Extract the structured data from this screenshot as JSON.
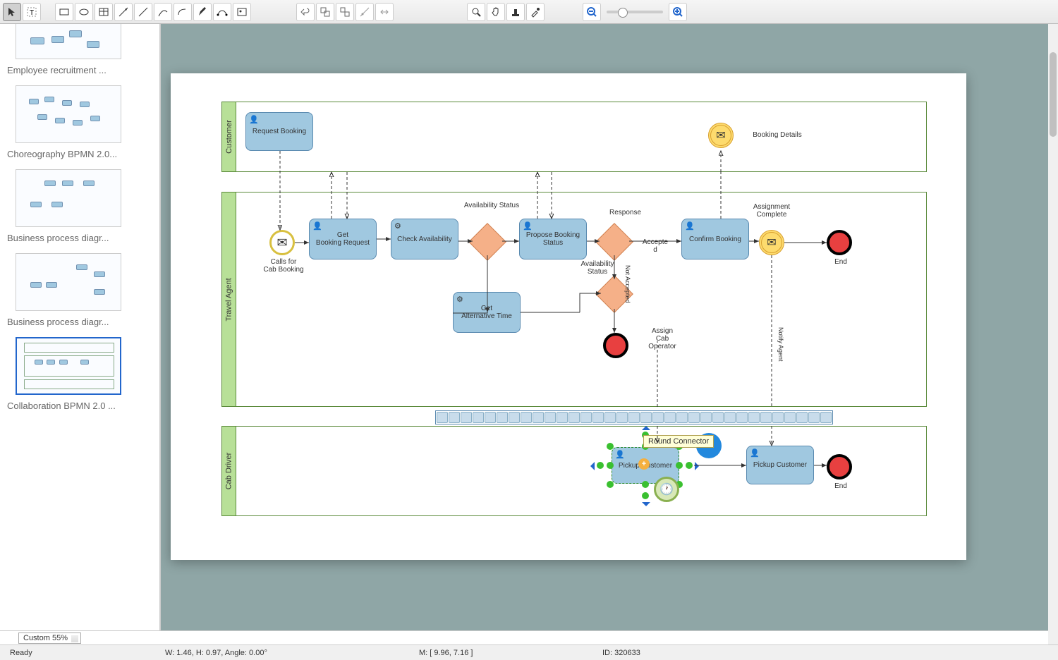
{
  "toolbar": {
    "tools": [
      "select",
      "text",
      "rect",
      "ellipse",
      "table",
      "connector",
      "line",
      "curve",
      "freehand",
      "pen",
      "dimension",
      "insert"
    ]
  },
  "sidebar": {
    "items": [
      {
        "label": "Employee recruitment ..."
      },
      {
        "label": "Choreography BPMN 2.0..."
      },
      {
        "label": "Business process diagr..."
      },
      {
        "label": "Business process diagr..."
      },
      {
        "label": "Collaboration BPMN 2.0 ..."
      }
    ]
  },
  "diagram": {
    "pools": [
      {
        "name": "Customer"
      },
      {
        "name": "Travel Agent"
      },
      {
        "name": "Cab Driver"
      }
    ],
    "tasks": {
      "request_booking": "Request Booking",
      "get_booking_request": "Get\nBooking Request",
      "check_availability": "Check Availability",
      "propose_booking_status": "Propose Booking Status",
      "get_alternative_time": "Get\nAlternative Time",
      "confirm_booking": "Confirm Booking",
      "pickup_customer_1": "Pickup Customer",
      "pickup_customer_2": "Pickup Customer"
    },
    "events": {
      "booking_details": "Booking Details",
      "calls_for_cab": "Calls for\nCab Booking",
      "assignment_complete": "Assignment\nComplete",
      "end1": "End",
      "end2": "End"
    },
    "labels": {
      "availability_status": "Availability Status",
      "availability_status_2": "Availability\nStatus",
      "response": "Response",
      "accepted": "Accepte\nd",
      "not_accepted": "Not Accepted",
      "assign_cab_operator": "Assign\nCab\nOperator",
      "notify_agent": "Notify Agent"
    }
  },
  "tooltip": "Round Connector",
  "statusbar": {
    "ready": "Ready",
    "zoom": "Custom 55%",
    "dims": "W: 1.46,  H: 0.97,  Angle: 0.00°",
    "mouse": "M: [ 9.96, 7.16 ]",
    "id": "ID: 320633"
  }
}
